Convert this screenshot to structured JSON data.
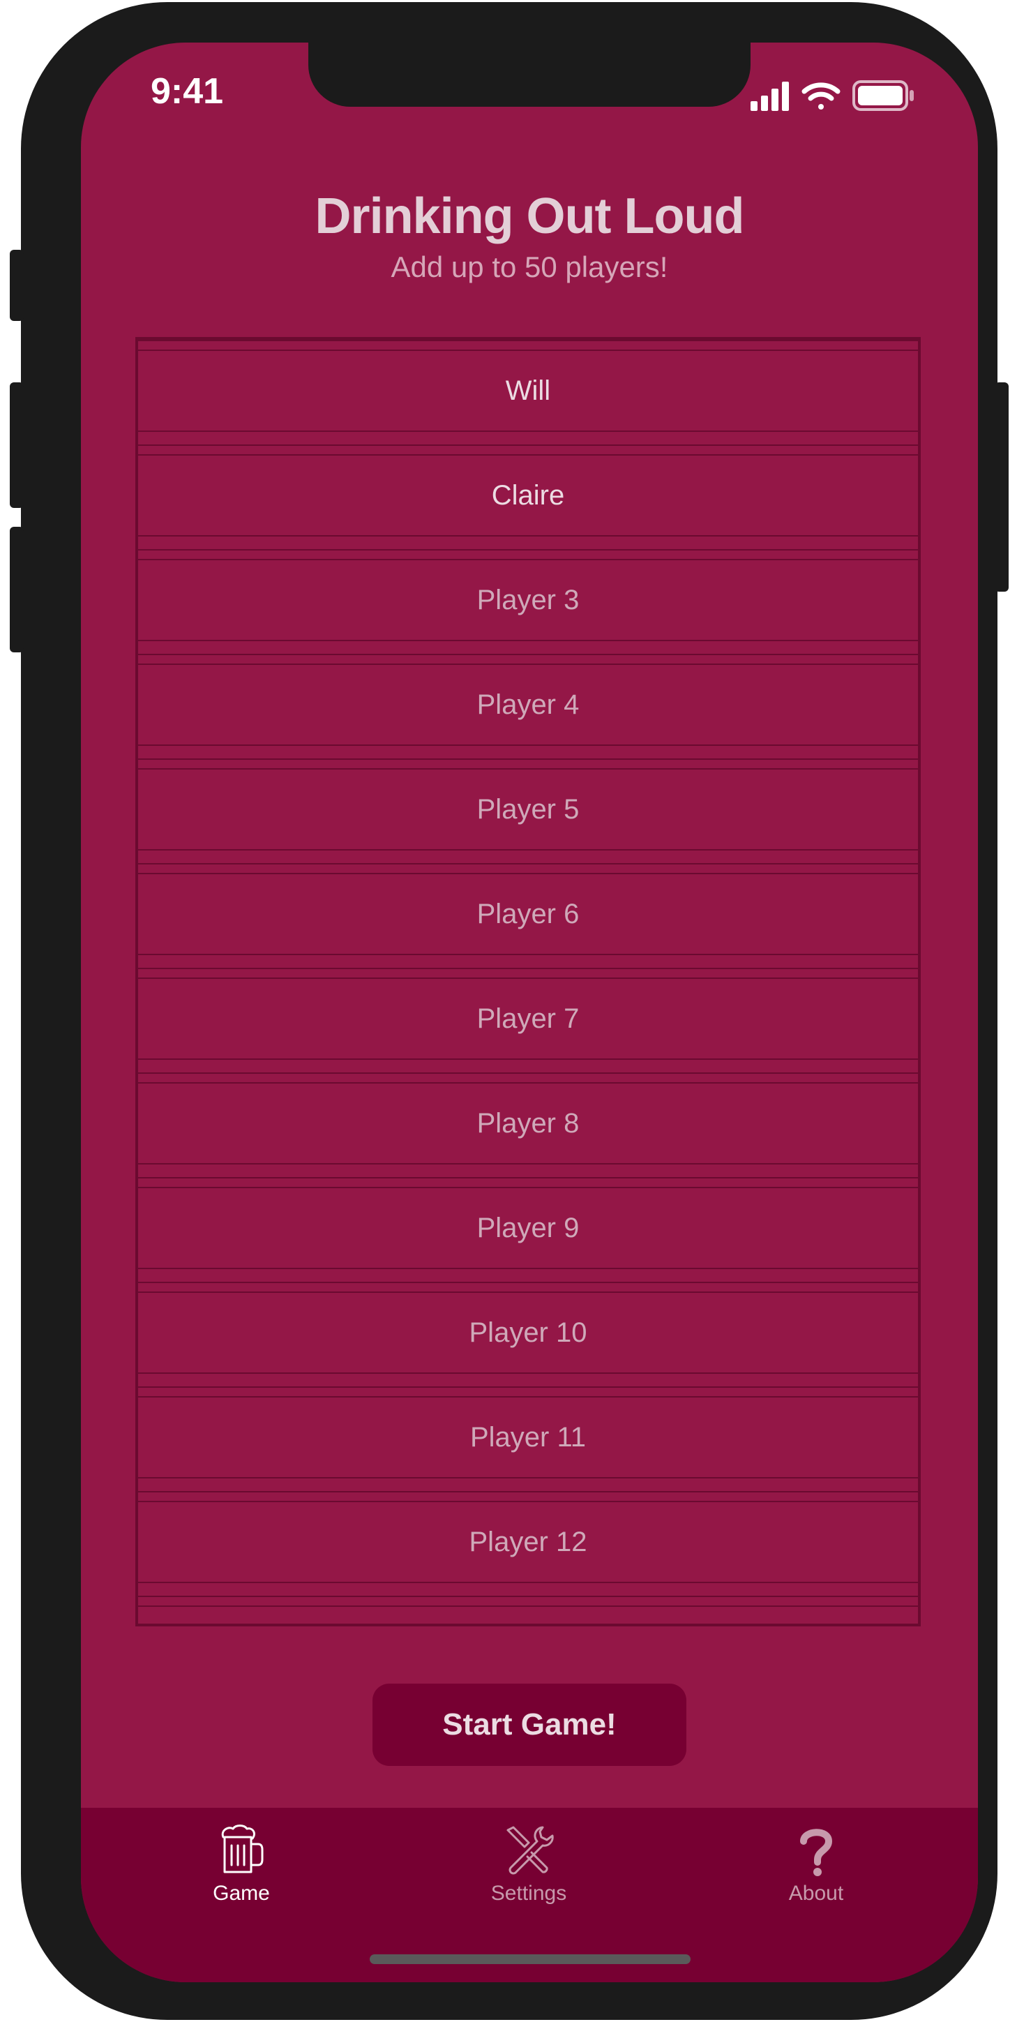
{
  "status_bar": {
    "time": "9:41"
  },
  "header": {
    "title": "Drinking Out Loud",
    "subtitle": "Add up to 50 players!"
  },
  "players": [
    {
      "value": "Will",
      "placeholder": ""
    },
    {
      "value": "Claire",
      "placeholder": ""
    },
    {
      "value": "",
      "placeholder": "Player 3"
    },
    {
      "value": "",
      "placeholder": "Player 4"
    },
    {
      "value": "",
      "placeholder": "Player 5"
    },
    {
      "value": "",
      "placeholder": "Player 6"
    },
    {
      "value": "",
      "placeholder": "Player 7"
    },
    {
      "value": "",
      "placeholder": "Player 8"
    },
    {
      "value": "",
      "placeholder": "Player 9"
    },
    {
      "value": "",
      "placeholder": "Player 10"
    },
    {
      "value": "",
      "placeholder": "Player 11"
    },
    {
      "value": "",
      "placeholder": "Player 12"
    }
  ],
  "actions": {
    "start_label": "Start Game!"
  },
  "tabs": [
    {
      "label": "Game",
      "icon": "beer-mug-icon",
      "active": true
    },
    {
      "label": "Settings",
      "icon": "tools-icon",
      "active": false
    },
    {
      "label": "About",
      "icon": "question-mark-icon",
      "active": false
    }
  ],
  "colors": {
    "background": "#941747",
    "tab_bar": "#770032",
    "button": "#770032",
    "text": "#ecdce3",
    "placeholder_text": "#cfa9b9"
  }
}
